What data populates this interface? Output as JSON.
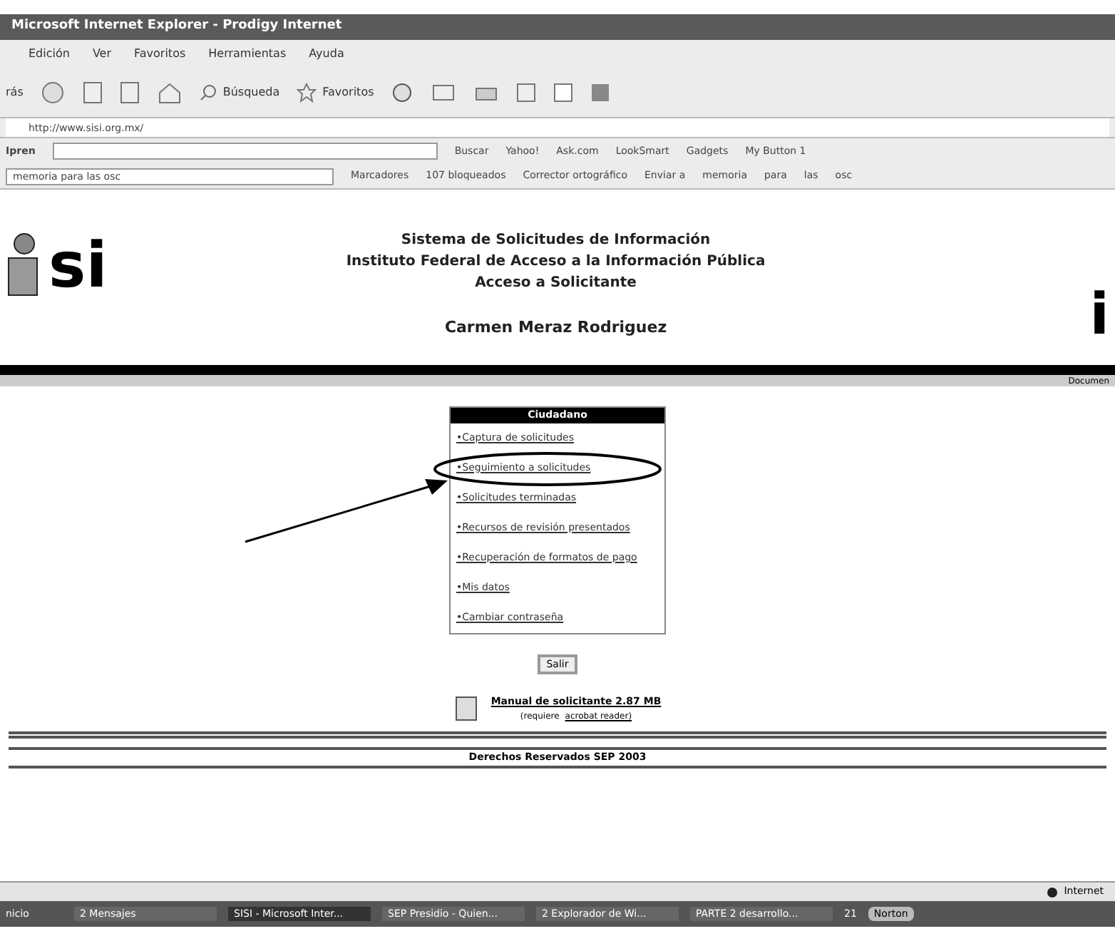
{
  "window": {
    "title": "Microsoft Internet Explorer - Prodigy Internet"
  },
  "menu_bar": [
    "Edición",
    "Ver",
    "Favoritos",
    "Herramientas",
    "Ayuda"
  ],
  "toolbar": [
    "rás",
    "Búsqueda",
    "Favoritos"
  ],
  "address_bar": {
    "value": "http://www.sisi.org.mx/"
  },
  "search_toolbar": {
    "label": "Ipren",
    "items": [
      "Buscar",
      "Yahoo!",
      "Ask.com",
      "LookSmart",
      "Gadgets",
      "My Button 1"
    ]
  },
  "links_toolbar": {
    "field": "memoria para las osc",
    "items": [
      "Marcadores",
      "107 bloqueados",
      "Corrector ortográfico",
      "Enviar a",
      "memoria",
      "para",
      "las",
      "osc"
    ]
  },
  "header": {
    "lines": [
      "Sistema de Solicitudes de Información",
      "Instituto Federal de Acceso a la Información Pública",
      "Acceso a Solicitante"
    ],
    "user": "Carmen Meraz Rodriguez",
    "logo": "si",
    "right_logo": "i",
    "gray_bar_text": "Documen"
  },
  "menu": {
    "title": "Ciudadano",
    "items": [
      {
        "label": "•Captura de solicitudes",
        "circled": false
      },
      {
        "label": "•Seguimiento a solicitudes",
        "circled": true
      },
      {
        "label": "•Solicitudes terminadas",
        "circled": false
      },
      {
        "label": "•Recursos de revisión presentados",
        "circled": false
      },
      {
        "label": "•Recuperación de formatos de pago",
        "circled": false
      },
      {
        "label": "•Mis datos",
        "circled": false
      },
      {
        "label": "•Cambiar contraseña",
        "circled": false
      }
    ]
  },
  "exit_button": "Salir",
  "manual": {
    "title": "Manual de solicitante 2.87 MB",
    "note_prefix": "(requiere",
    "note_link": "acrobat reader)"
  },
  "footer": "Derechos Reservados SEP 2003",
  "status_bar": {
    "zone": "Internet"
  },
  "taskbar": {
    "start": "nicio",
    "items": [
      "2 Mensajes",
      "SISI - Microsoft Inter...",
      "SEP Presidio - Quien...",
      "2 Explorador de Wi...",
      "PARTE 2 desarrollo..."
    ],
    "clock": "21",
    "norton": "Norton"
  }
}
